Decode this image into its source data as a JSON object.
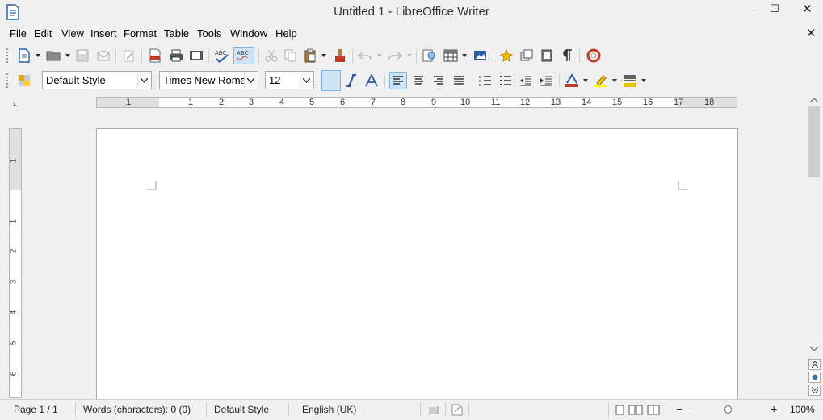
{
  "window": {
    "title": "Untitled 1 - LibreOffice Writer",
    "min_glyph": "—",
    "max_glyph": "☐",
    "close_glyph": "✕"
  },
  "menu": {
    "items": [
      "File",
      "Edit",
      "View",
      "Insert",
      "Format",
      "Table",
      "Tools",
      "Window",
      "Help"
    ],
    "close_glyph": "✕"
  },
  "formatting": {
    "paragraph_style": "Default Style",
    "font_name": "Times New Roman",
    "font_size": "12"
  },
  "ruler": {
    "corner_glyph": "⌞",
    "h_numbers": [
      "1",
      "1",
      "2",
      "3",
      "4",
      "5",
      "6",
      "7",
      "8",
      "9",
      "10",
      "11",
      "12",
      "13",
      "14",
      "15",
      "16",
      "17",
      "18"
    ],
    "v_numbers": [
      "1",
      "1",
      "2",
      "3",
      "4",
      "5",
      "6"
    ]
  },
  "status": {
    "page": "Page 1 / 1",
    "words": "Words (characters): 0 (0)",
    "style": "Default Style",
    "language": "English (UK)",
    "zoom": "100%",
    "zoom_minus": "−",
    "zoom_plus": "+"
  },
  "colors": {
    "accent": "#3a6fbf",
    "active_bg": "#cfe3f7",
    "page_bg": "#ffffff",
    "workspace_bg": "#f0f0f0"
  }
}
